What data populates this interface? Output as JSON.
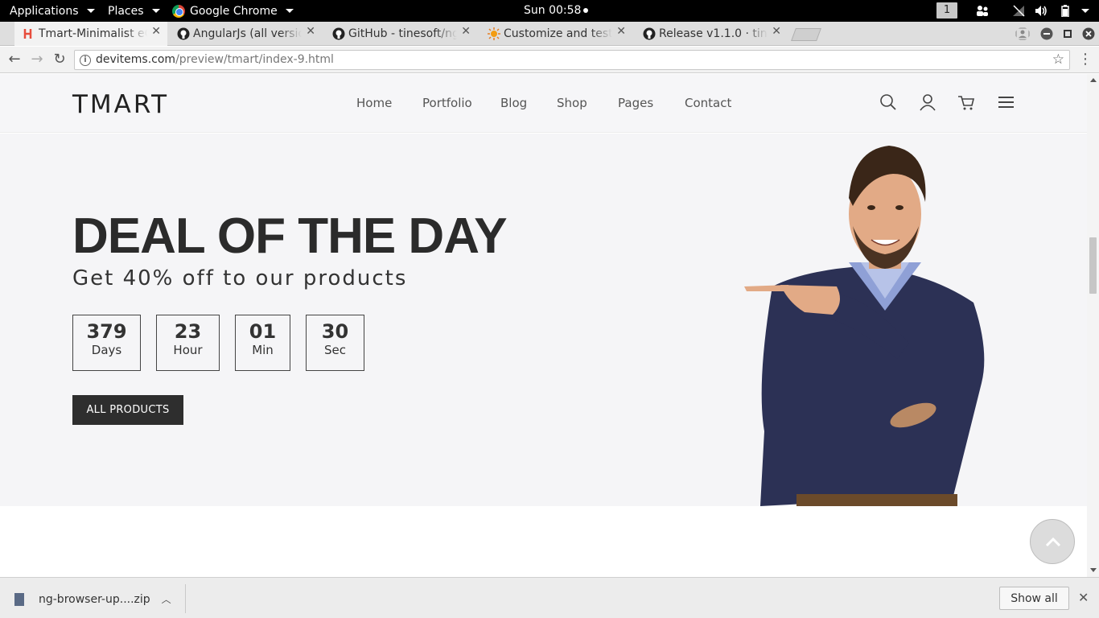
{
  "os_bar": {
    "applications": "Applications",
    "places": "Places",
    "browser_app": "Google Chrome",
    "clock": "Sun 00:58",
    "workspace": "1"
  },
  "tabs": [
    {
      "title": "Tmart-Minimalist eCo",
      "active": true
    },
    {
      "title": "AngularJs (all version",
      "active": false
    },
    {
      "title": "GitHub - tinesoft/ng",
      "active": false
    },
    {
      "title": "Customize and test",
      "active": false
    },
    {
      "title": "Release v1.1.0 · tine",
      "active": false
    }
  ],
  "address": {
    "host": "devitems.com",
    "path": "/preview/tmart/index-9.html"
  },
  "site": {
    "logo": "TMART",
    "nav": [
      "Home",
      "Portfolio",
      "Blog",
      "Shop",
      "Pages",
      "Contact"
    ]
  },
  "hero": {
    "title": "DEAL OF THE DAY",
    "subtitle": "Get 40% off to our products",
    "countdown": [
      {
        "value": "379",
        "unit": "Days"
      },
      {
        "value": "23",
        "unit": "Hour"
      },
      {
        "value": "01",
        "unit": "Min"
      },
      {
        "value": "30",
        "unit": "Sec"
      }
    ],
    "button": "ALL PRODUCTS"
  },
  "download_shelf": {
    "file": "ng-browser-up....zip",
    "show_all": "Show all"
  },
  "icons": {
    "search": "search-icon",
    "account": "user-icon",
    "cart": "cart-icon",
    "menu": "hamburger-icon",
    "back_to_top": "chevron-up-icon"
  }
}
